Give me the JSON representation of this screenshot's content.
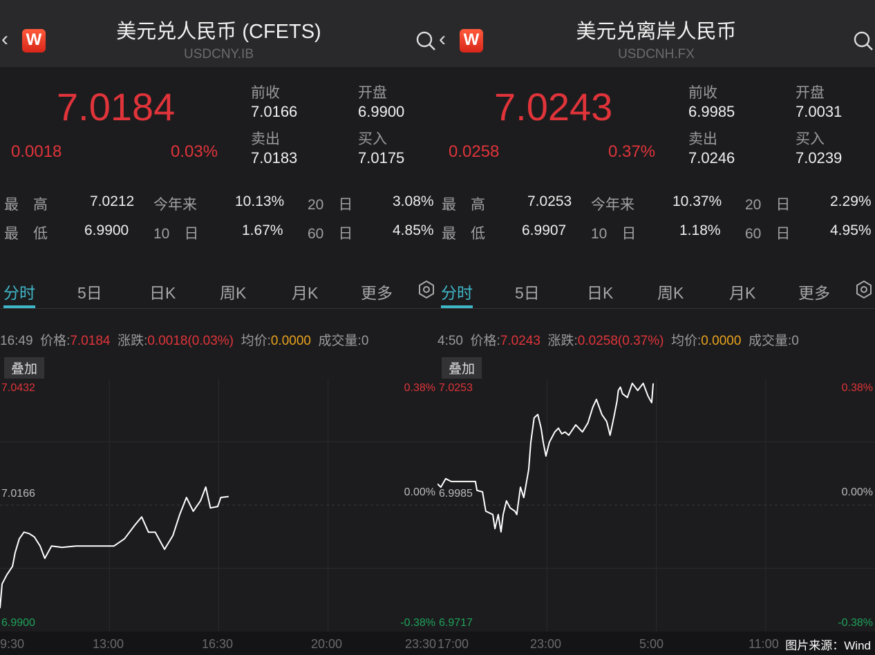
{
  "colors": {
    "up": "#e0343a",
    "down": "#1fa35a",
    "accent": "#3fb6c8",
    "avg": "#e8a21d",
    "line": "#ffffff"
  },
  "icons": {
    "back": "chevron-left-icon",
    "logo": "wind-logo",
    "search": "search-icon",
    "settings": "hexagon-gear-icon"
  },
  "source_label": "图片来源：Wind",
  "panels": [
    {
      "title": "美元兑人民币 (CFETS)",
      "code": "USDCNY.IB",
      "logo_text": "W",
      "price": "7.0184",
      "change": "0.0018",
      "change_pct": "0.03%",
      "quotes": [
        {
          "label": "前收",
          "value": "7.0166"
        },
        {
          "label": "开盘",
          "value": "6.9900"
        },
        {
          "label": "卖出",
          "value": "7.0183"
        },
        {
          "label": "买入",
          "value": "7.0175"
        }
      ],
      "stats": [
        {
          "label": "最　高",
          "value": "7.0212"
        },
        {
          "label": "今年来",
          "value": "10.13%"
        },
        {
          "label": "20　日",
          "value": "3.08%"
        },
        {
          "label": "最　低",
          "value": "6.9900"
        },
        {
          "label": "10　日",
          "value": "1.67%"
        },
        {
          "label": "60　日",
          "value": "4.85%"
        }
      ],
      "tabs": [
        "分时",
        "5日",
        "日K",
        "周K",
        "月K",
        "更多"
      ],
      "active_tab": 0,
      "info": {
        "time": "16:49",
        "price_label": "价格:",
        "price": "7.0184",
        "chg_label": "涨跌:",
        "chg": "0.0018(0.03%)",
        "avg_label": "均价:",
        "avg": "0.0000",
        "vol_label": "成交量:",
        "vol": "0"
      },
      "overlay_label": "叠加",
      "chart_data": {
        "type": "line",
        "y_left_labels": {
          "top": "7.0432",
          "mid": "7.0166",
          "bottom": "6.9900"
        },
        "y_right_labels": {
          "top": "0.38%",
          "mid": "0.00%",
          "bottom": "-0.38%"
        },
        "ylim": [
          6.99,
          7.0432
        ],
        "baseline": 7.0166,
        "x_ticks": [
          "9:30",
          "13:00",
          "16:30",
          "20:00",
          "23:30"
        ],
        "x_range": [
          "09:30",
          "23:30"
        ],
        "points": [
          [
            "09:30",
            6.9949
          ],
          [
            "09:34",
            7.0
          ],
          [
            "09:43",
            7.0019
          ],
          [
            "09:54",
            7.0037
          ],
          [
            "09:59",
            7.0066
          ],
          [
            "10:07",
            7.0095
          ],
          [
            "10:16",
            7.0109
          ],
          [
            "10:26",
            7.0106
          ],
          [
            "10:36",
            7.0099
          ],
          [
            "10:47",
            7.008
          ],
          [
            "10:56",
            7.0054
          ],
          [
            "11:09",
            7.008
          ],
          [
            "11:29",
            7.0077
          ],
          [
            "11:56",
            7.008
          ],
          [
            "12:22",
            7.008
          ],
          [
            "12:49",
            7.008
          ],
          [
            "13:09",
            7.008
          ],
          [
            "13:29",
            7.0095
          ],
          [
            "13:49",
            7.0124
          ],
          [
            "14:02",
            7.0141
          ],
          [
            "14:15",
            7.0109
          ],
          [
            "14:28",
            7.0109
          ],
          [
            "14:46",
            7.0073
          ],
          [
            "15:02",
            7.0102
          ],
          [
            "15:15",
            7.0146
          ],
          [
            "15:28",
            7.0182
          ],
          [
            "15:41",
            7.0153
          ],
          [
            "15:55",
            7.0175
          ],
          [
            "16:05",
            7.0204
          ],
          [
            "16:14",
            7.016
          ],
          [
            "16:28",
            7.0163
          ],
          [
            "16:34",
            7.0182
          ],
          [
            "16:49",
            7.0184
          ]
        ]
      }
    },
    {
      "title": "美元兑离岸人民币",
      "code": "USDCNH.FX",
      "logo_text": "W",
      "price": "7.0243",
      "change": "0.0258",
      "change_pct": "0.37%",
      "quotes": [
        {
          "label": "前收",
          "value": "6.9985"
        },
        {
          "label": "开盘",
          "value": "7.0031"
        },
        {
          "label": "卖出",
          "value": "7.0246"
        },
        {
          "label": "买入",
          "value": "7.0239"
        }
      ],
      "stats": [
        {
          "label": "最　高",
          "value": "7.0253"
        },
        {
          "label": "今年来",
          "value": "10.37%"
        },
        {
          "label": "20　日",
          "value": "2.29%"
        },
        {
          "label": "最　低",
          "value": "6.9907"
        },
        {
          "label": "10　日",
          "value": "1.18%"
        },
        {
          "label": "60　日",
          "value": "4.95%"
        }
      ],
      "tabs": [
        "分时",
        "5日",
        "日K",
        "周K",
        "月K",
        "更多"
      ],
      "active_tab": 0,
      "info": {
        "time": "4:50",
        "price_label": "价格:",
        "price": "7.0243",
        "chg_label": "涨跌:",
        "chg": "0.0258(0.37%)",
        "avg_label": "均价:",
        "avg": "0.0000",
        "vol_label": "成交量:",
        "vol": "0"
      },
      "overlay_label": "叠加",
      "chart_data": {
        "type": "line",
        "y_left_labels": {
          "top": "7.0253",
          "mid": "6.9985",
          "bottom": "6.9717"
        },
        "y_right_labels": {
          "top": "0.38%",
          "mid": "0.00%",
          "bottom": "-0.38%"
        },
        "ylim": [
          6.9717,
          7.0253
        ],
        "baseline": 6.9985,
        "x_ticks": [
          "17:00",
          "23:00",
          "5:00",
          "11:00",
          ""
        ],
        "x_range": [
          "17:00",
          "17:00 (+1)"
        ],
        "points": [
          [
            "17:00",
            7.003
          ],
          [
            "17:11",
            7.0023
          ],
          [
            "17:27",
            7.0041
          ],
          [
            "17:45",
            7.0035
          ],
          [
            "18:31",
            7.0035
          ],
          [
            "19:05",
            7.0035
          ],
          [
            "19:10",
            7.0016
          ],
          [
            "19:28",
            7.0013
          ],
          [
            "19:39",
            6.9972
          ],
          [
            "20:02",
            6.9965
          ],
          [
            "20:09",
            6.9935
          ],
          [
            "20:20",
            6.9965
          ],
          [
            "20:29",
            6.9928
          ],
          [
            "20:36",
            6.9965
          ],
          [
            "20:47",
            6.9994
          ],
          [
            "20:59",
            6.9979
          ],
          [
            "21:15",
            6.9972
          ],
          [
            "21:21",
            6.9965
          ],
          [
            "21:33",
            7.0023
          ],
          [
            "21:44",
            7.0001
          ],
          [
            "22:00",
            7.006
          ],
          [
            "22:07",
            7.0118
          ],
          [
            "22:18",
            7.017
          ],
          [
            "22:30",
            7.0177
          ],
          [
            "22:41",
            7.0148
          ],
          [
            "22:48",
            7.0118
          ],
          [
            "22:57",
            7.0089
          ],
          [
            "23:08",
            7.0118
          ],
          [
            "23:26",
            7.014
          ],
          [
            "23:38",
            7.0148
          ],
          [
            "23:49",
            7.0136
          ],
          [
            "00:00",
            7.014
          ],
          [
            "00:12",
            7.0133
          ],
          [
            "00:35",
            7.0155
          ],
          [
            "00:57",
            7.014
          ],
          [
            "01:15",
            7.0159
          ],
          [
            "01:31",
            7.0192
          ],
          [
            "01:43",
            7.0209
          ],
          [
            "02:01",
            7.0177
          ],
          [
            "02:17",
            7.0162
          ],
          [
            "02:28",
            7.0133
          ],
          [
            "02:40",
            7.017
          ],
          [
            "02:51",
            7.0206
          ],
          [
            "02:55",
            7.0228
          ],
          [
            "03:02",
            7.0235
          ],
          [
            "03:09",
            7.0221
          ],
          [
            "03:25",
            7.0213
          ],
          [
            "03:41",
            7.0243
          ],
          [
            "03:59",
            7.0228
          ],
          [
            "04:17",
            7.0243
          ],
          [
            "04:33",
            7.0216
          ],
          [
            "04:45",
            7.0202
          ],
          [
            "04:50",
            7.0243
          ]
        ]
      }
    }
  ]
}
